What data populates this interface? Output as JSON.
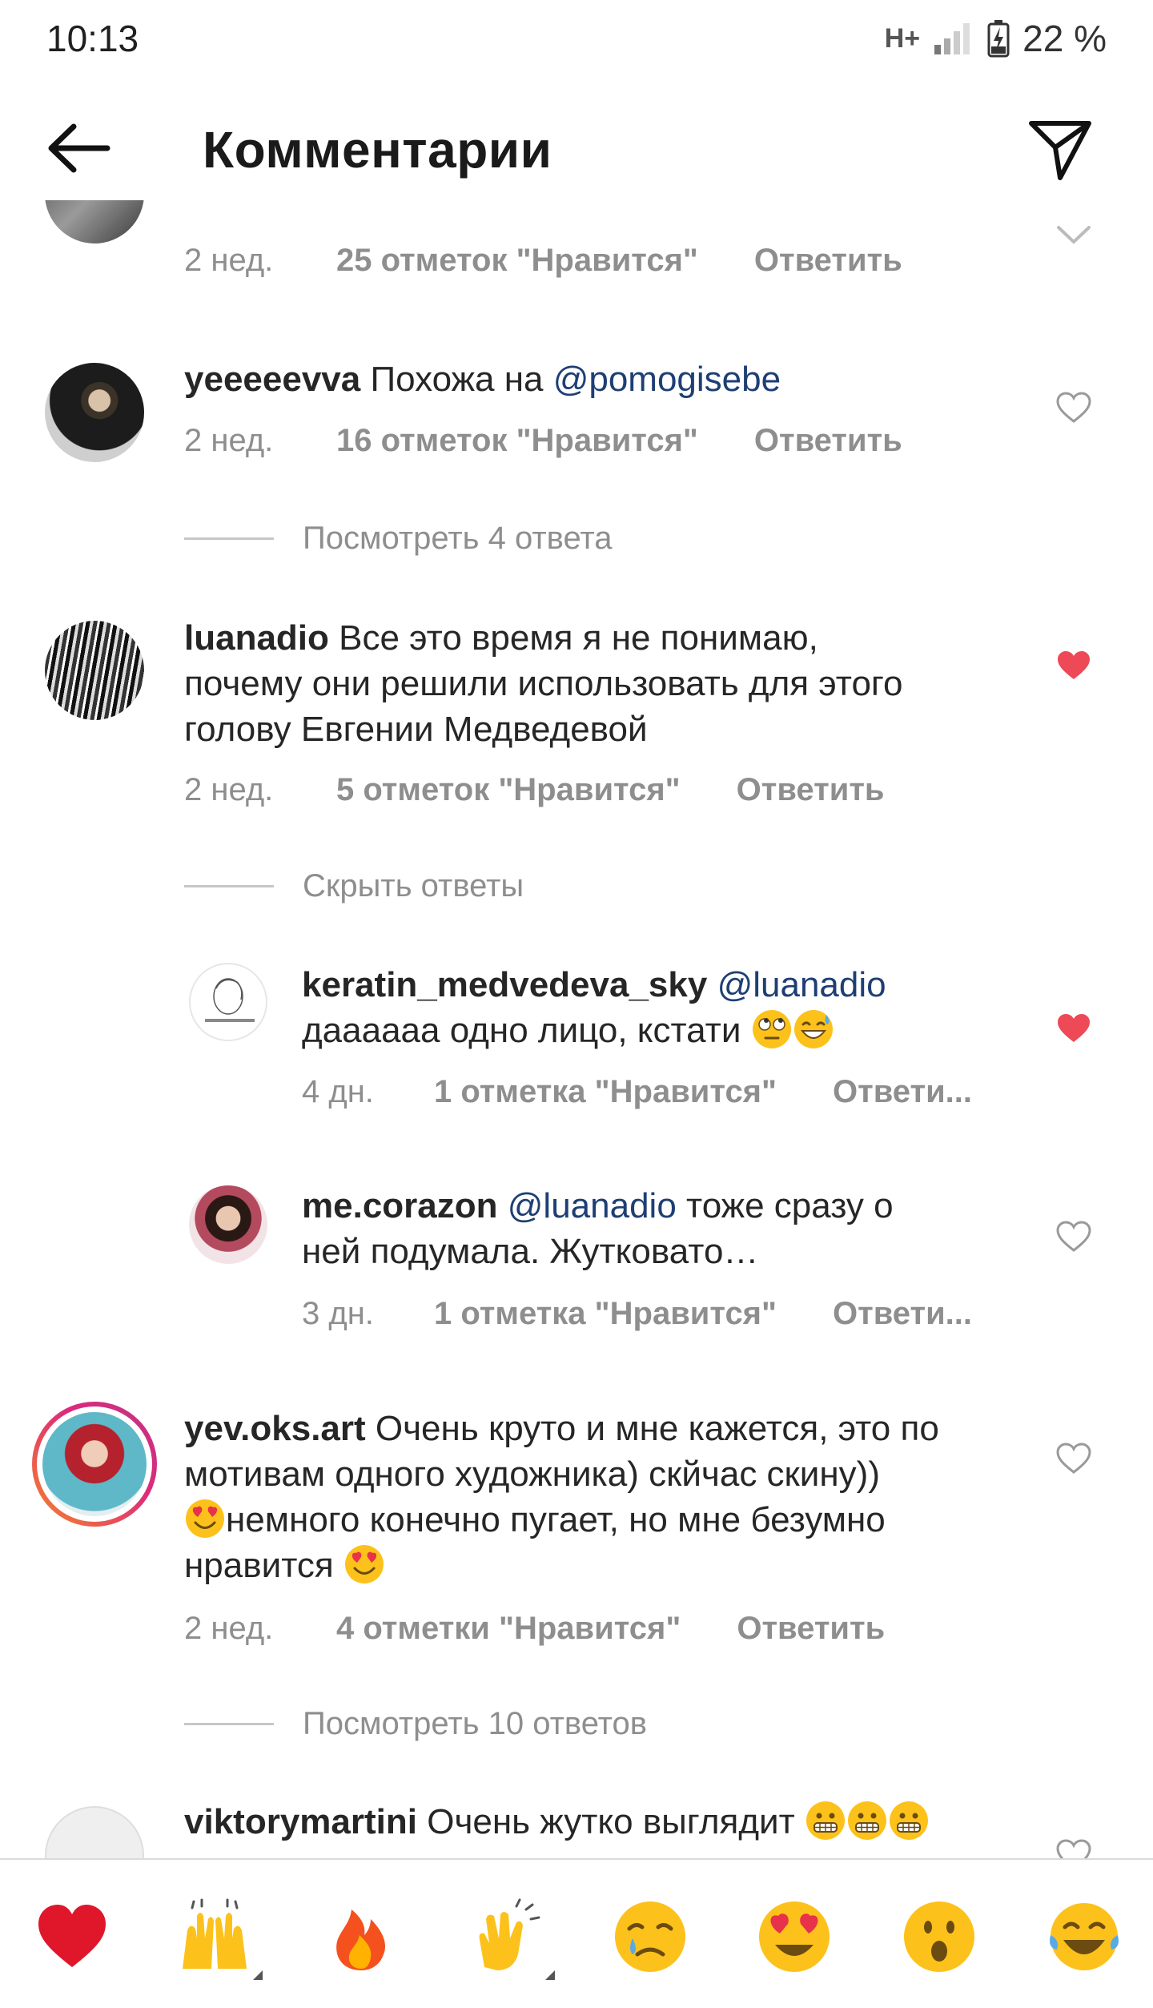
{
  "status_bar": {
    "time": "10:13",
    "network": "H+",
    "battery": "22 %"
  },
  "header": {
    "title": "Комментарии"
  },
  "comments": [
    {
      "id": "c0",
      "meta": {
        "time": "2 нед.",
        "likes": "25 отметок \"Нравится\"",
        "reply": "Ответить"
      }
    },
    {
      "id": "c1",
      "username": "yeeeeevva",
      "text_before": "Похожа на ",
      "mention": "@pomogisebe",
      "meta": {
        "time": "2 нед.",
        "likes": "16 отметок \"Нравится\"",
        "reply": "Ответить"
      },
      "thread": "Посмотреть 4 ответа"
    },
    {
      "id": "c2",
      "username": "luanadio",
      "text_line1": "Все это время я не понимаю,",
      "text_line2": "почему они решили использовать для этого",
      "text_line3": "голову Евгении Медведевой",
      "liked": true,
      "meta": {
        "time": "2 нед.",
        "likes": "5 отметок \"Нравится\"",
        "reply": "Ответить"
      },
      "thread": "Скрыть ответы"
    },
    {
      "id": "r1",
      "username": "keratin_medvedeva_sky",
      "mention": "@luanadio",
      "text_line2": "дааааaa одно лицо, кстати",
      "emojis": [
        "face-with-rolling-eyes",
        "grinning-face-with-sweat"
      ],
      "liked": true,
      "meta": {
        "time": "4 дн.",
        "likes": "1 отметка \"Нравится\"",
        "reply": "Ответи..."
      }
    },
    {
      "id": "r2",
      "username": "me.corazon",
      "mention": "@luanadio",
      "text_after": "тоже сразу о",
      "text_line2": "ней подумала. Жутковато…",
      "meta": {
        "time": "3 дн.",
        "likes": "1 отметка \"Нравится\"",
        "reply": "Ответи..."
      }
    },
    {
      "id": "c3",
      "username": "yev.oks.art",
      "text_line1": "Очень круто и мне кажется, это по",
      "text_line2": "мотивам одного художника) скйчас скину))",
      "text_line3": "немного конечно пугает, но мне безумно",
      "text_line4": "нравится",
      "emojis": [
        "heart-eyes"
      ],
      "meta": {
        "time": "2 нед.",
        "likes": "4 отметки \"Нравится\"",
        "reply": "Ответить"
      },
      "thread": "Посмотреть 10 ответов"
    },
    {
      "id": "c4",
      "username": "viktorymartini",
      "text_before": "Очень жутко выглядит",
      "emojis": [
        "grimacing-face",
        "grimacing-face",
        "grimacing-face"
      ]
    }
  ],
  "reactions": [
    "heart",
    "raising-hands",
    "fire",
    "clapping-hands",
    "crying-face",
    "heart-eyes",
    "open-mouth-face",
    "tears-of-joy"
  ],
  "colors": {
    "text": "#262626",
    "secondary": "#8e8e8e",
    "mention": "#1e3f74",
    "like_red": "#ed4956",
    "story_ring_a": "#f58529",
    "story_ring_b": "#dd2a7b"
  }
}
